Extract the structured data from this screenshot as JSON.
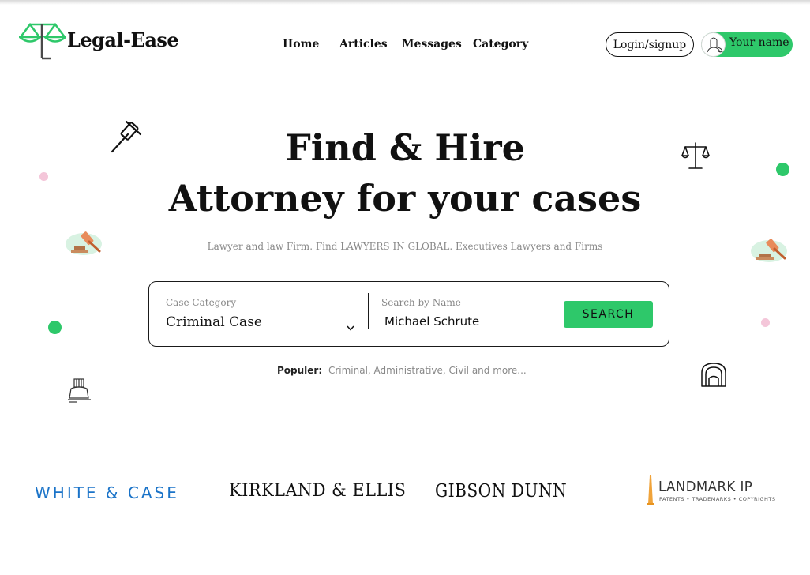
{
  "header": {
    "brand": "Legal-Ease",
    "nav": [
      "Home",
      "Articles",
      "Messages",
      "Category"
    ],
    "login_label": "Login/signup",
    "user_name": "Your name"
  },
  "hero": {
    "title_line1": "Find & Hire",
    "title_line2": "Attorney for your cases",
    "subtitle": "Lawyer and law Firm. Find LAWYERS IN GLOBAL. Executives Lawyers and Firms"
  },
  "search": {
    "category_label": "Case Category",
    "category_value": "Criminal Case",
    "name_label": "Search by Name",
    "name_value": "Michael Schrute",
    "button_label": "SEARCH"
  },
  "popular": {
    "label": "Populer:",
    "text": "Criminal, Administrative, Civil and more..."
  },
  "firms": {
    "white_case": "WHITE & CASE",
    "kirkland": "KIRKLAND & ELLIS",
    "gibson": "GIBSON DUNN",
    "landmark": "LANDMARK IP",
    "landmark_tagline": "PATENTS • TRADEMARKS • COPYRIGHTS"
  },
  "colors": {
    "accent_green": "#2ec86a",
    "dot_pink": "#f4c6d9",
    "white_case_blue": "#1a73c8"
  },
  "icons": [
    "scales-logo-icon",
    "gavel-icon",
    "scales-icon",
    "judge-gavel-icon",
    "court-building-icon",
    "helmet-icon",
    "chevron-down-icon",
    "user-avatar-icon"
  ]
}
